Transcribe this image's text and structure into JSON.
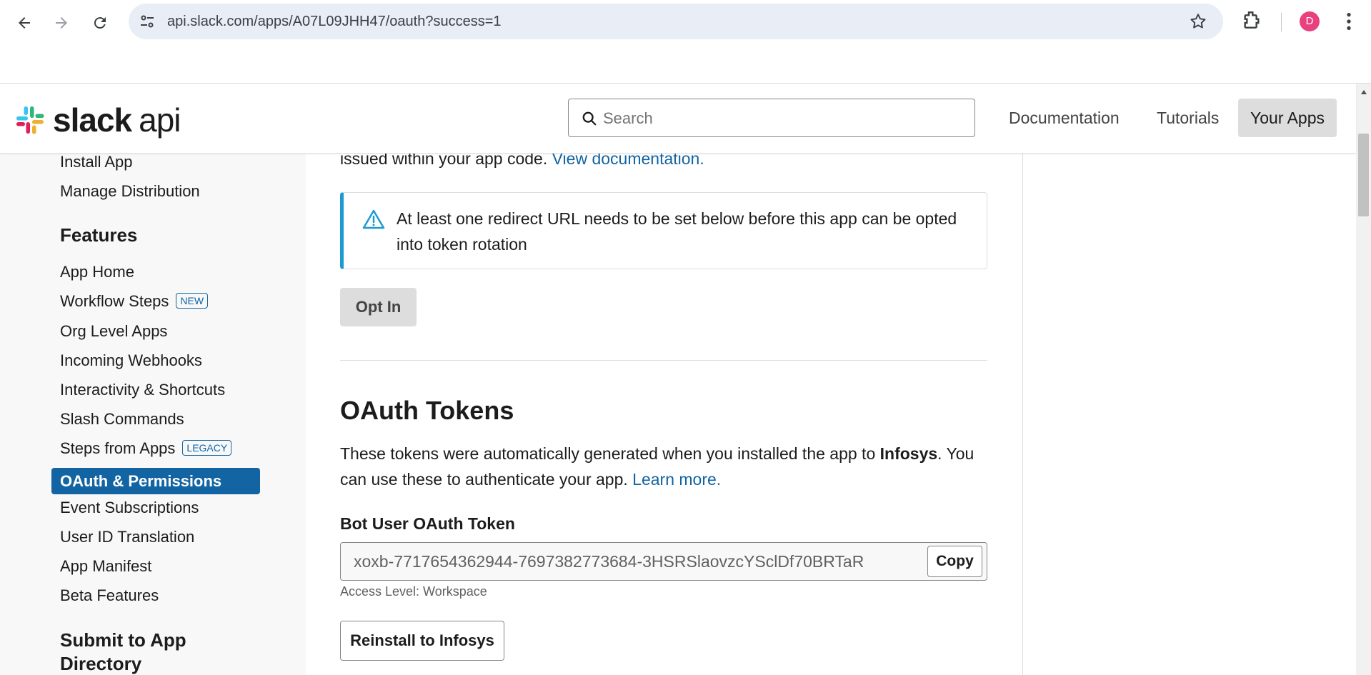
{
  "browser": {
    "url": "api.slack.com/apps/A07L09JHH47/oauth?success=1",
    "avatar_letter": "D"
  },
  "header": {
    "logo_text": "slack",
    "logo_api": "api",
    "search_placeholder": "Search",
    "links": [
      "Documentation",
      "Tutorials",
      "Your Apps"
    ]
  },
  "sidebar": {
    "top_items": [
      "Install App",
      "Manage Distribution"
    ],
    "features_heading": "Features",
    "features": [
      {
        "label": "App Home"
      },
      {
        "label": "Workflow Steps",
        "badge": "NEW"
      },
      {
        "label": "Org Level Apps"
      },
      {
        "label": "Incoming Webhooks"
      },
      {
        "label": "Interactivity & Shortcuts"
      },
      {
        "label": "Slash Commands"
      },
      {
        "label": "Steps from Apps",
        "badge": "LEGACY"
      },
      {
        "label": "OAuth & Permissions",
        "active": true
      },
      {
        "label": "Event Subscriptions"
      },
      {
        "label": "User ID Translation"
      },
      {
        "label": "App Manifest"
      },
      {
        "label": "Beta Features"
      }
    ],
    "submit_heading_line1": "Submit to App",
    "submit_heading_line2": "Directory"
  },
  "main": {
    "intro_text": "issued within your app code.",
    "intro_link": "View documentation.",
    "alert_text": "At least one redirect URL needs to be set below before this app can be opted into token rotation",
    "opt_in_label": "Opt In",
    "section_title": "OAuth Tokens",
    "desc_part1": "These tokens were automatically generated when you installed the app to",
    "desc_workspace": "Infosys",
    "desc_part2": ". You can use these to authenticate your app.",
    "desc_link": "Learn more.",
    "token_label": "Bot User OAuth Token",
    "token_value": "xoxb-7717654362944-7697382773684-3HSRSlaovzcYSclDf70BRTaR",
    "copy_label": "Copy",
    "access_level": "Access Level: Workspace",
    "reinstall_label": "Reinstall to Infosys"
  },
  "colors": {
    "accent": "#1264a3",
    "alert_border": "#1d9bd1",
    "avatar": "#e8417e"
  }
}
